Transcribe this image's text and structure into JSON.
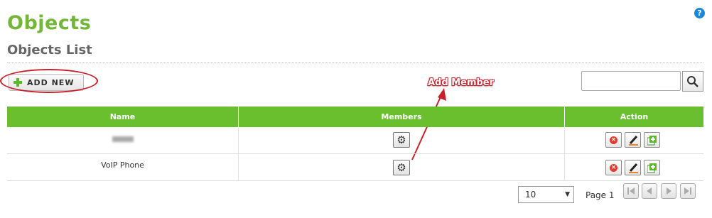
{
  "header": {
    "title": "Objects",
    "subtitle": "Objects List",
    "help_glyph": "?"
  },
  "toolbar": {
    "add_new_label": "ADD NEW",
    "search_value": "",
    "search_placeholder": ""
  },
  "annotation": {
    "text": "Add Member",
    "color": "#c8202a"
  },
  "table": {
    "columns": [
      "Name",
      "Members",
      "Action"
    ],
    "rows": [
      {
        "name": "",
        "name_redacted": true
      },
      {
        "name": "VoIP Phone",
        "name_redacted": false
      }
    ]
  },
  "pagination": {
    "page_size": "10",
    "page_label": "Page 1"
  },
  "colors": {
    "accent": "#74b637",
    "header_bg": "#6abf2e",
    "annotation": "#c8202a"
  },
  "icons": [
    "help-icon",
    "plus-icon",
    "search-icon",
    "gear-icon",
    "delete-icon",
    "edit-icon",
    "add-member-icon",
    "first-page-icon",
    "prev-page-icon",
    "next-page-icon",
    "last-page-icon"
  ]
}
